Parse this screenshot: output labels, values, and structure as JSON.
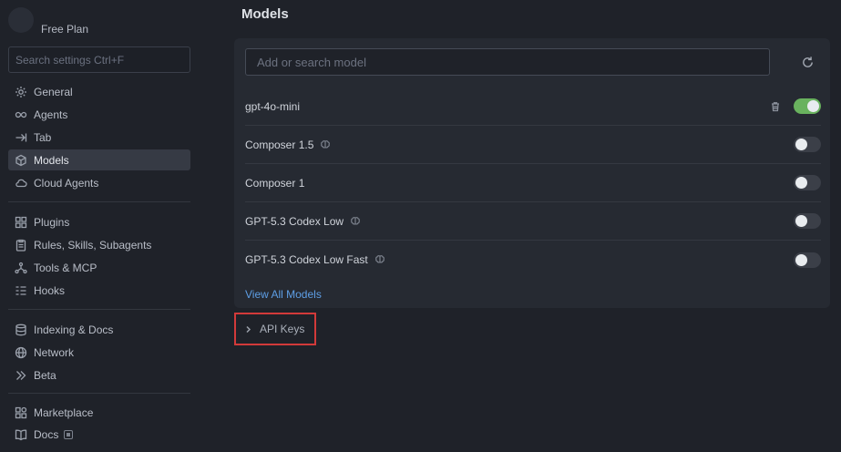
{
  "sidebar": {
    "plan": "Free Plan",
    "search_placeholder": "Search settings Ctrl+F",
    "group1": [
      {
        "label": "General",
        "icon": "gear-icon"
      },
      {
        "label": "Agents",
        "icon": "infinity-icon"
      },
      {
        "label": "Tab",
        "icon": "tab-arrow-icon"
      },
      {
        "label": "Models",
        "icon": "cube-icon",
        "active": true
      },
      {
        "label": "Cloud Agents",
        "icon": "cloud-icon"
      }
    ],
    "group2": [
      {
        "label": "Plugins",
        "icon": "plugin-icon"
      },
      {
        "label": "Rules, Skills, Subagents",
        "icon": "clipboard-icon"
      },
      {
        "label": "Tools & MCP",
        "icon": "tools-icon"
      },
      {
        "label": "Hooks",
        "icon": "hooks-icon"
      }
    ],
    "group3": [
      {
        "label": "Indexing & Docs",
        "icon": "database-icon"
      },
      {
        "label": "Network",
        "icon": "globe-icon"
      },
      {
        "label": "Beta",
        "icon": "double-chevron-icon"
      }
    ],
    "group4": [
      {
        "label": "Marketplace",
        "icon": "marketplace-icon"
      },
      {
        "label": "Docs",
        "icon": "book-icon"
      }
    ]
  },
  "main": {
    "title": "Models",
    "search_placeholder": "Add or search model",
    "models": [
      {
        "name": "gpt-4o-mini",
        "enabled": true,
        "deletable": true,
        "thinking": false
      },
      {
        "name": "Composer 1.5",
        "enabled": false,
        "thinking": true
      },
      {
        "name": "Composer 1",
        "enabled": false,
        "thinking": false
      },
      {
        "name": "GPT-5.3 Codex Low",
        "enabled": false,
        "thinking": true
      },
      {
        "name": "GPT-5.3 Codex Low Fast",
        "enabled": false,
        "thinking": true
      }
    ],
    "view_all": "View All Models",
    "api_keys": "API Keys"
  },
  "colors": {
    "accent_link": "#5e9fe6",
    "toggle_on": "#69b25e",
    "highlight_border": "#d23a3a"
  }
}
